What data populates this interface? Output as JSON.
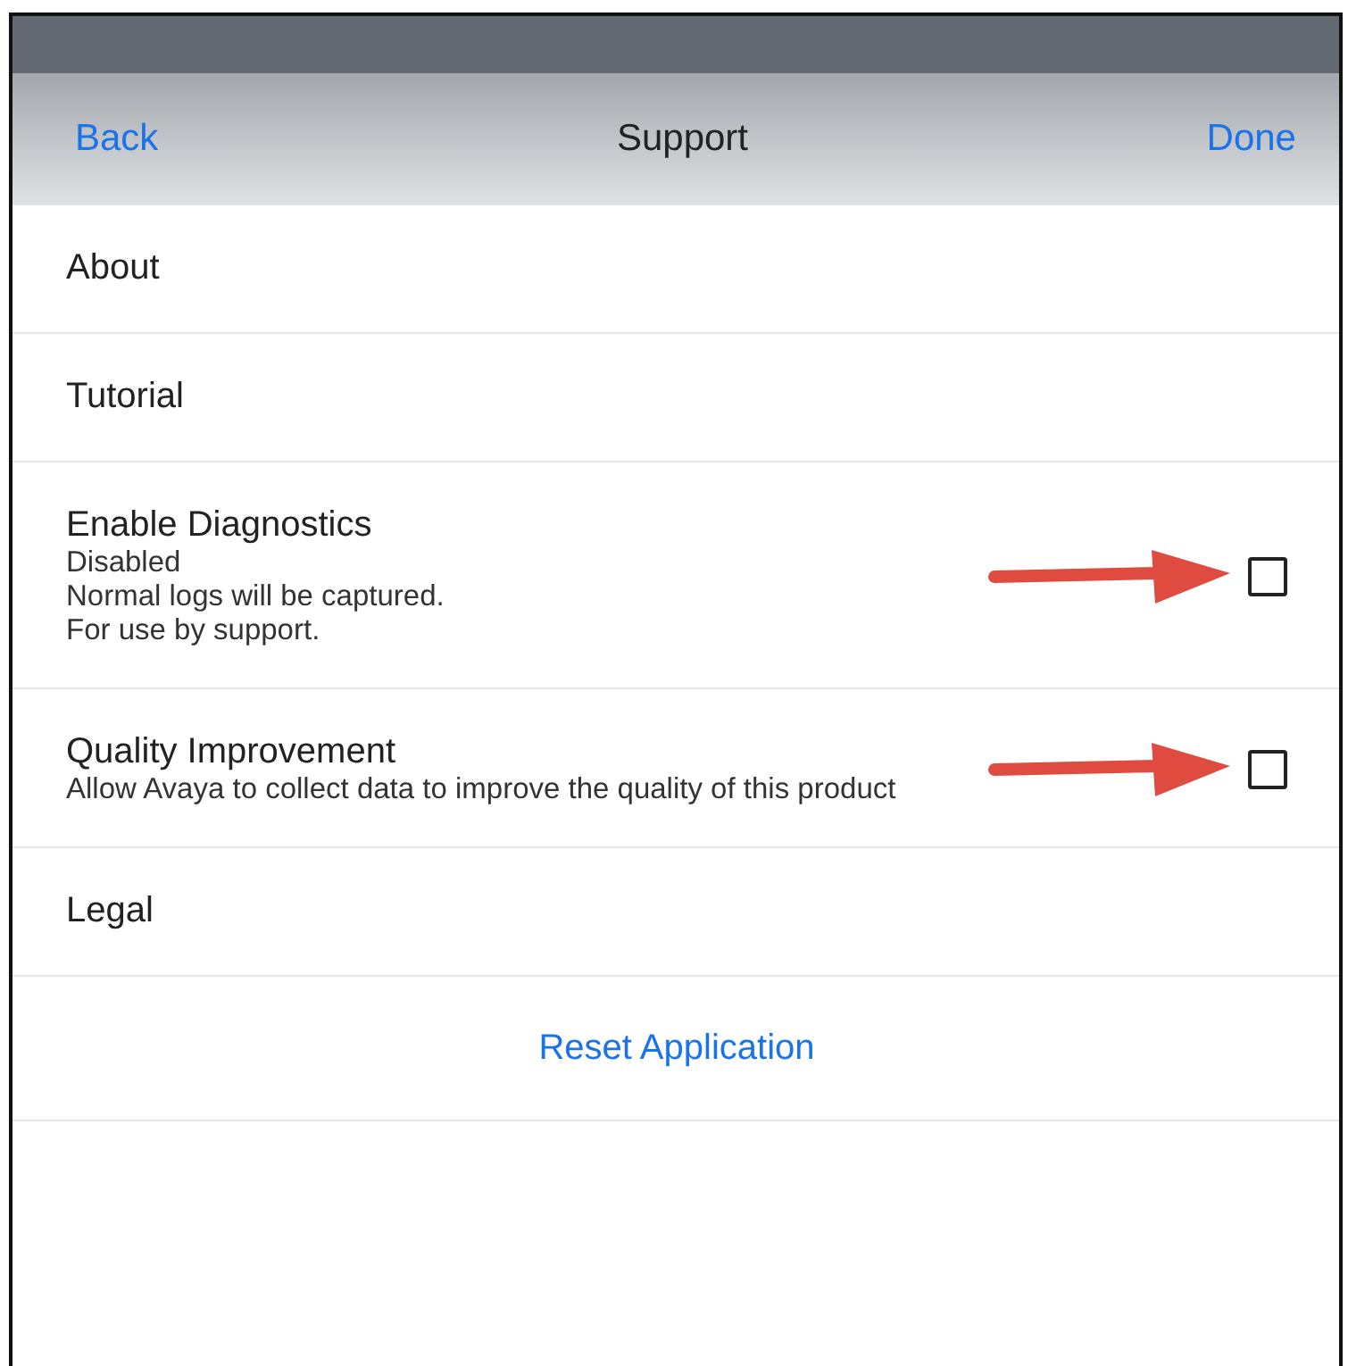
{
  "nav_bar": {
    "back": "Back",
    "title": "Support",
    "done": "Done"
  },
  "items": [
    {
      "kind": "link",
      "label": "About"
    },
    {
      "kind": "link",
      "label": "Tutorial"
    },
    {
      "kind": "checkbox",
      "label": "Enable Diagnostics",
      "lines": [
        "Disabled",
        "Normal logs will be captured.",
        "For use by support."
      ],
      "checked": false,
      "arrow": true
    },
    {
      "kind": "checkbox",
      "label": "Quality Improvement",
      "lines": [
        "Allow Avaya to collect data to improve the quality of this product"
      ],
      "checked": false,
      "arrow": true
    },
    {
      "kind": "link",
      "label": "Legal"
    },
    {
      "kind": "action",
      "label": "Reset Application"
    }
  ]
}
